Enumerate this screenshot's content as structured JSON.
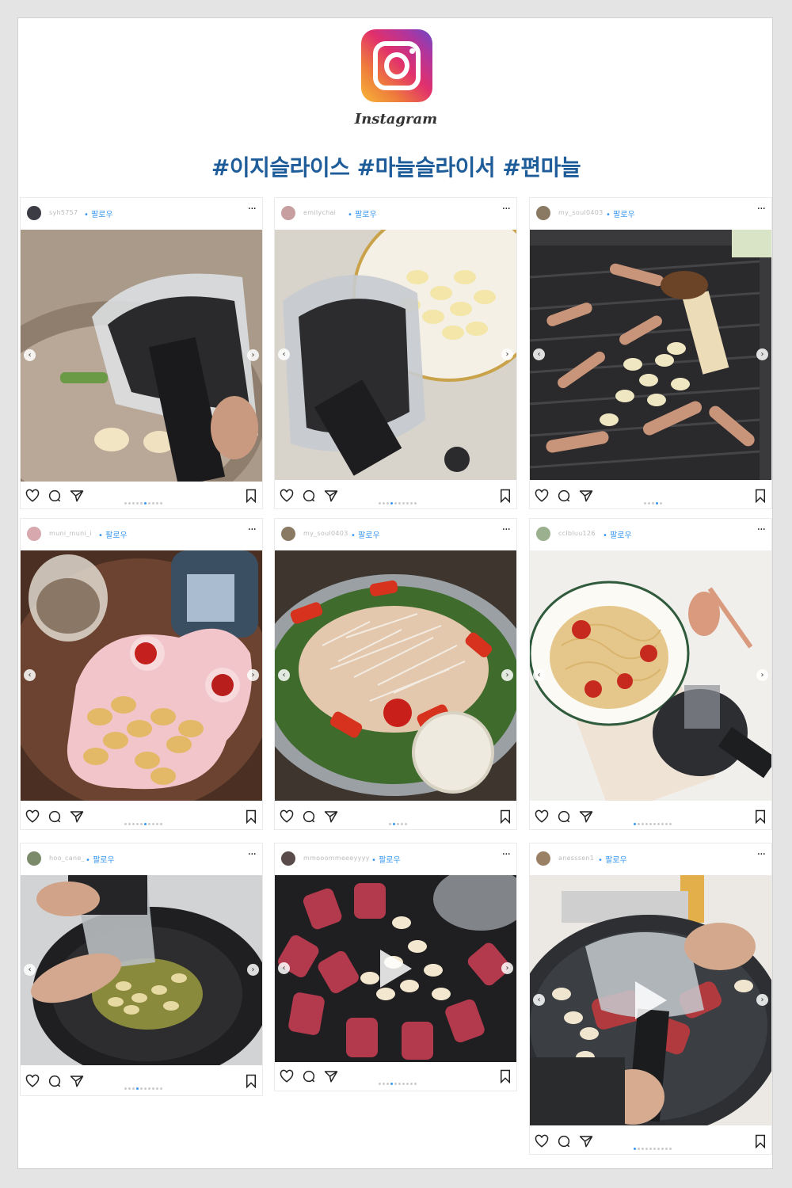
{
  "header": {
    "brand": "Instagram",
    "hashtags": "#이지슬라이스 #마늘슬라이서 #편마늘",
    "colors": {
      "hashtag": "#1f5d9a",
      "follow": "#3897f0"
    }
  },
  "posts": [
    {
      "username": "syh5757",
      "follow": "팔로우",
      "dot": "•",
      "more": "···",
      "dots_total": 10,
      "dots_active": 5,
      "video": false,
      "scene": "pan-slicer"
    },
    {
      "username": "emilychai",
      "follow": "팔로우",
      "dot": "•",
      "more": "···",
      "dots_total": 10,
      "dots_active": 3,
      "video": false,
      "scene": "slicer-garlic-plate"
    },
    {
      "username": "my_soul0403",
      "follow": "팔로우",
      "dot": "•",
      "more": "···",
      "dots_total": 5,
      "dots_active": 3,
      "video": false,
      "scene": "grill-pork-garlic"
    },
    {
      "username": "muni_muni_i",
      "follow": "팔로우",
      "dot": "•",
      "more": "···",
      "dots_total": 10,
      "dots_active": 5,
      "video": false,
      "scene": "garlic-chips-tray"
    },
    {
      "username": "my_soul0403",
      "follow": "팔로우",
      "dot": "•",
      "more": "···",
      "dots_total": 5,
      "dots_active": 1,
      "video": false,
      "scene": "salad"
    },
    {
      "username": "cclbluu126",
      "follow": "팔로우",
      "dot": "•",
      "more": "···",
      "dots_total": 10,
      "dots_active": 0,
      "video": false,
      "scene": "pasta"
    },
    {
      "username": "hoo_cane_",
      "follow": "팔로우",
      "dot": "•",
      "more": "···",
      "dots_total": 10,
      "dots_active": 3,
      "video": false,
      "scene": "wok-oil"
    },
    {
      "username": "mmooommeeeyyyy",
      "follow": "팔로우",
      "dot": "•",
      "more": "···",
      "dots_total": 10,
      "dots_active": 3,
      "video": true,
      "scene": "beef-rolls"
    },
    {
      "username": "anesssen1",
      "follow": "팔로우",
      "dot": "•",
      "more": "···",
      "dots_total": 10,
      "dots_active": 0,
      "video": true,
      "scene": "griddle-beef"
    }
  ],
  "icons": [
    "heart-icon",
    "comment-icon",
    "share-icon",
    "bookmark-icon",
    "chevron-left-icon",
    "chevron-right-icon",
    "play-icon"
  ]
}
